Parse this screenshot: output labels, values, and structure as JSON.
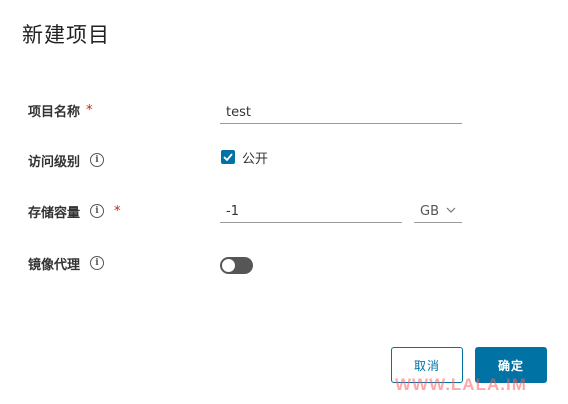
{
  "dialog": {
    "title": "新建项目"
  },
  "form": {
    "project_name": {
      "label": "项目名称",
      "required_mark": "*",
      "value": "test"
    },
    "access_level": {
      "label": "访问级别",
      "info_icon": "info-icon",
      "checkbox_label": "公开",
      "checked": true
    },
    "storage": {
      "label": "存储容量",
      "info_icon": "info-icon",
      "required_mark": "*",
      "value": "-1",
      "unit": "GB"
    },
    "proxy_cache": {
      "label": "镜像代理",
      "info_icon": "info-icon",
      "enabled": false
    }
  },
  "buttons": {
    "cancel": "取消",
    "ok": "确定"
  },
  "watermark": "WWW.LALA.IM",
  "colors": {
    "primary": "#0072a3",
    "required": "#c92100",
    "toggle_off": "#565656"
  }
}
